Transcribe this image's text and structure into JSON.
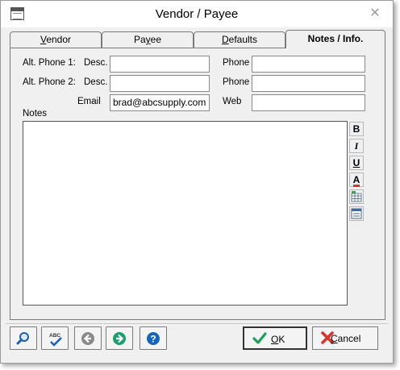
{
  "window": {
    "title": "Vendor / Payee",
    "close_glyph": "✕"
  },
  "tabs": [
    {
      "label_pre": "",
      "label_acc": "V",
      "label_post": "endor",
      "active": false
    },
    {
      "label_pre": "Pa",
      "label_acc": "y",
      "label_post": "ee",
      "active": false
    },
    {
      "label_pre": "",
      "label_acc": "D",
      "label_post": "efaults",
      "active": false
    },
    {
      "label_pre": "",
      "label_acc": "",
      "label_post": "Notes / Info.",
      "active": true
    }
  ],
  "form": {
    "alt_phone1_label": "Alt. Phone 1:",
    "alt_phone2_label": "Alt. Phone 2:",
    "desc_label": "Desc.",
    "phone_label": "Phone",
    "email_label": "Email",
    "web_label": "Web",
    "alt_phone1_desc": "",
    "alt_phone1_phone": "",
    "alt_phone2_desc": "",
    "alt_phone2_phone": "",
    "email": "brad@abcsupply.com",
    "web": "",
    "notes_label": "Notes",
    "notes": ""
  },
  "formatting": {
    "bold": "B",
    "italic": "I",
    "underline": "U",
    "font_color": "A"
  },
  "toolbar": {
    "icons": [
      "search-icon",
      "spell-check-icon",
      "back-arrow-icon",
      "forward-arrow-icon",
      "help-icon"
    ],
    "spell_text": "ABC",
    "help_glyph": "?"
  },
  "buttons": {
    "ok": "OK",
    "ok_accel": "O",
    "cancel": "Cancel",
    "cancel_accel": "C"
  },
  "colors": {
    "ok_check": "#1aa05a",
    "cancel_x": "#d9342b",
    "forward_arrow": "#1a9f6e",
    "help_blue": "#1565c0",
    "search_blue": "#1a5fb4"
  }
}
